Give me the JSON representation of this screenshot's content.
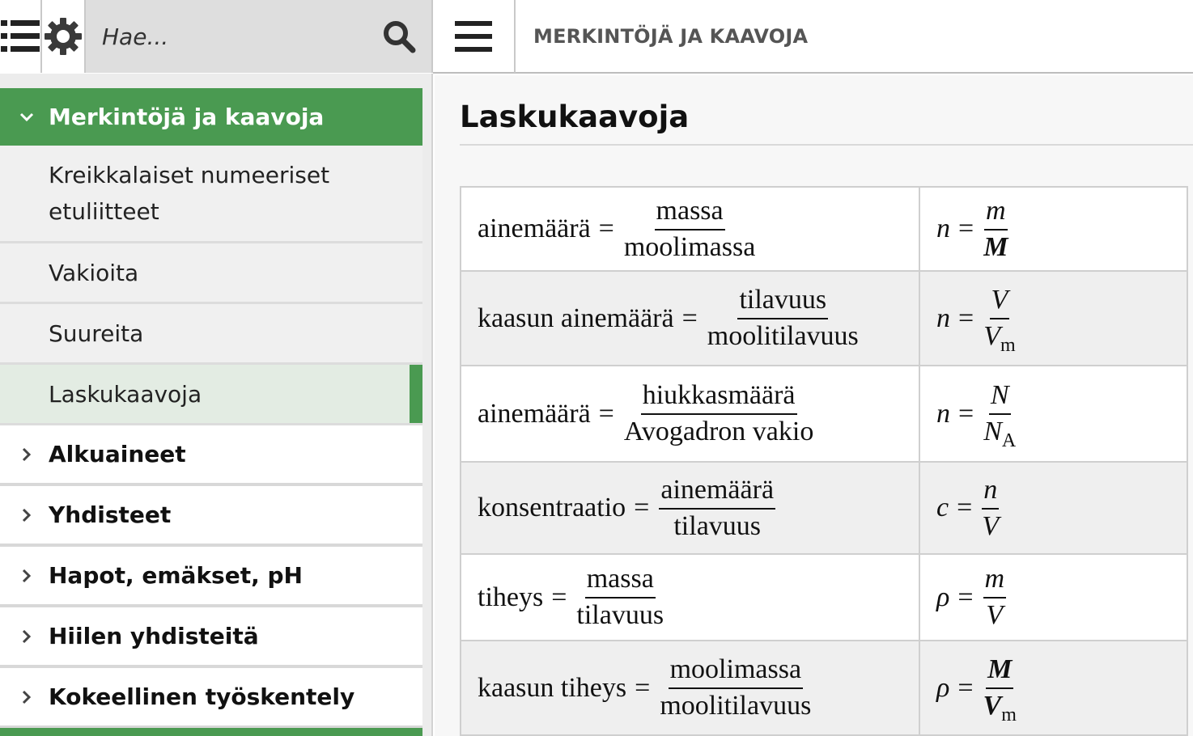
{
  "toolbar": {
    "menu_icon": "list-menu-icon",
    "settings_icon": "gear-icon",
    "search_placeholder": "Hae...",
    "search_icon": "search-icon"
  },
  "header": {
    "menu_icon": "hamburger-icon",
    "title": "MERKINTÖJÄ JA KAAVOJA"
  },
  "sidebar": {
    "active_section": "Merkintöjä ja kaavoja",
    "subitems": [
      {
        "label_line1": "Kreikkalaiset numeeriset",
        "label_line2": "etuliitteet"
      },
      {
        "label": "Vakioita"
      },
      {
        "label": "Suureita"
      },
      {
        "label": "Laskukaavoja",
        "selected": true
      }
    ],
    "sections": [
      {
        "label": "Alkuaineet"
      },
      {
        "label": "Yhdisteet"
      },
      {
        "label": "Hapot, emäkset, pH"
      },
      {
        "label": "Hiilen yhdisteitä"
      },
      {
        "label": "Kokeellinen työskentely"
      }
    ],
    "accent_color": "#4a9a51"
  },
  "main": {
    "title": "Laskukaavoja",
    "formulas": [
      {
        "lhs": "ainemäärä",
        "eq": "=",
        "num": "massa",
        "den": "moolimassa",
        "sym_lhs": "n",
        "sym_eq": "=",
        "sym_num": "m",
        "sym_den": "M",
        "sym_den_sub": ""
      },
      {
        "lhs": "kaasun ainemäärä",
        "eq": "=",
        "num": "tilavuus",
        "den": "moolitilavuus",
        "sym_lhs": "n",
        "sym_eq": "=",
        "sym_num": "V",
        "sym_den": "V",
        "sym_den_sub": "m"
      },
      {
        "lhs": "ainemäärä",
        "eq": "=",
        "num": "hiukkasmäärä",
        "den": "Avogadron vakio",
        "sym_lhs": "n",
        "sym_eq": "=",
        "sym_num": "N",
        "sym_den": "N",
        "sym_den_sub": "A"
      },
      {
        "lhs": "konsentraatio",
        "eq": "=",
        "num": "ainemäärä",
        "den": "tilavuus",
        "sym_lhs": "c",
        "sym_eq": "=",
        "sym_num": "n",
        "sym_den": "V",
        "sym_den_sub": ""
      },
      {
        "lhs": "tiheys",
        "eq": "=",
        "num": "massa",
        "den": "tilavuus",
        "sym_lhs": "ρ",
        "sym_eq": "=",
        "sym_num": "m",
        "sym_den": "V",
        "sym_den_sub": ""
      },
      {
        "lhs": "kaasun tiheys",
        "eq": "=",
        "num": "moolimassa",
        "den": "moolitilavuus",
        "sym_lhs": "ρ",
        "sym_eq": "=",
        "sym_num": "M",
        "sym_den": "V",
        "sym_den_sub": "m"
      }
    ]
  }
}
